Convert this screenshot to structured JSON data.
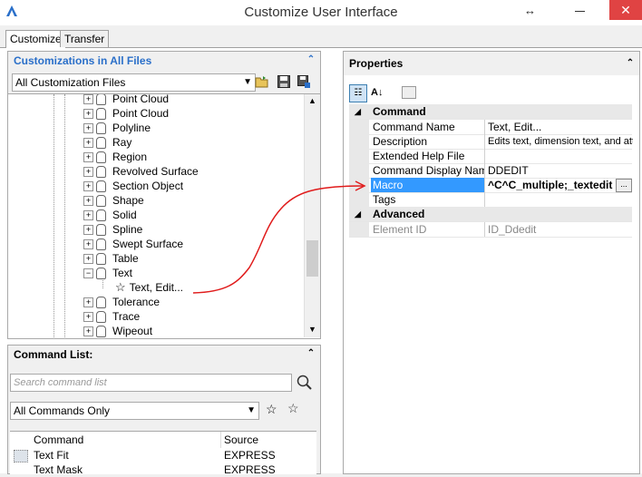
{
  "window": {
    "title": "Customize User Interface",
    "resize_glyph": "↔",
    "close_glyph": "✕"
  },
  "tabs": [
    {
      "label": "Customize"
    },
    {
      "label": "Transfer"
    }
  ],
  "customizations": {
    "header": "Customizations in All Files",
    "collapse_glyph": "⌃",
    "file_select": "All Customization Files",
    "tree": [
      {
        "label": "Point Cloud"
      },
      {
        "label": "Point Cloud"
      },
      {
        "label": "Polyline"
      },
      {
        "label": "Ray"
      },
      {
        "label": "Region"
      },
      {
        "label": "Revolved Surface"
      },
      {
        "label": "Section Object"
      },
      {
        "label": "Shape"
      },
      {
        "label": "Solid"
      },
      {
        "label": "Spline"
      },
      {
        "label": "Swept Surface"
      },
      {
        "label": "Table"
      },
      {
        "label": "Text"
      },
      {
        "label": "Text, Edit..."
      },
      {
        "label": "Tolerance"
      },
      {
        "label": "Trace"
      },
      {
        "label": "Wipeout"
      }
    ]
  },
  "command_list": {
    "header": "Command List:",
    "search_placeholder": "Search command list",
    "filter": "All Commands Only",
    "columns": {
      "command": "Command",
      "source": "Source"
    },
    "rows": [
      {
        "command": "Text Fit",
        "source": "EXPRESS"
      },
      {
        "command": "Text Mask",
        "source": "EXPRESS"
      }
    ]
  },
  "properties": {
    "header": "Properties",
    "categories": [
      {
        "name": "Command",
        "rows": [
          {
            "name": "Command Name",
            "value": "Text, Edit..."
          },
          {
            "name": "Description",
            "value": "Edits text, dimension text, and attr"
          },
          {
            "name": "Extended Help File",
            "value": ""
          },
          {
            "name": "Command Display Name",
            "value": "DDEDIT"
          },
          {
            "name": "Macro",
            "value": "^C^C_multiple;_textedit",
            "button": "..."
          },
          {
            "name": "Tags",
            "value": ""
          }
        ]
      },
      {
        "name": "Advanced",
        "rows": [
          {
            "name": "Element ID",
            "value": "ID_Ddedit"
          }
        ]
      }
    ]
  },
  "colors": {
    "accent_blue": "#2a6fc9",
    "selection": "#3399ff",
    "annotation_red": "#e01b1b",
    "close_red": "#e04343"
  }
}
